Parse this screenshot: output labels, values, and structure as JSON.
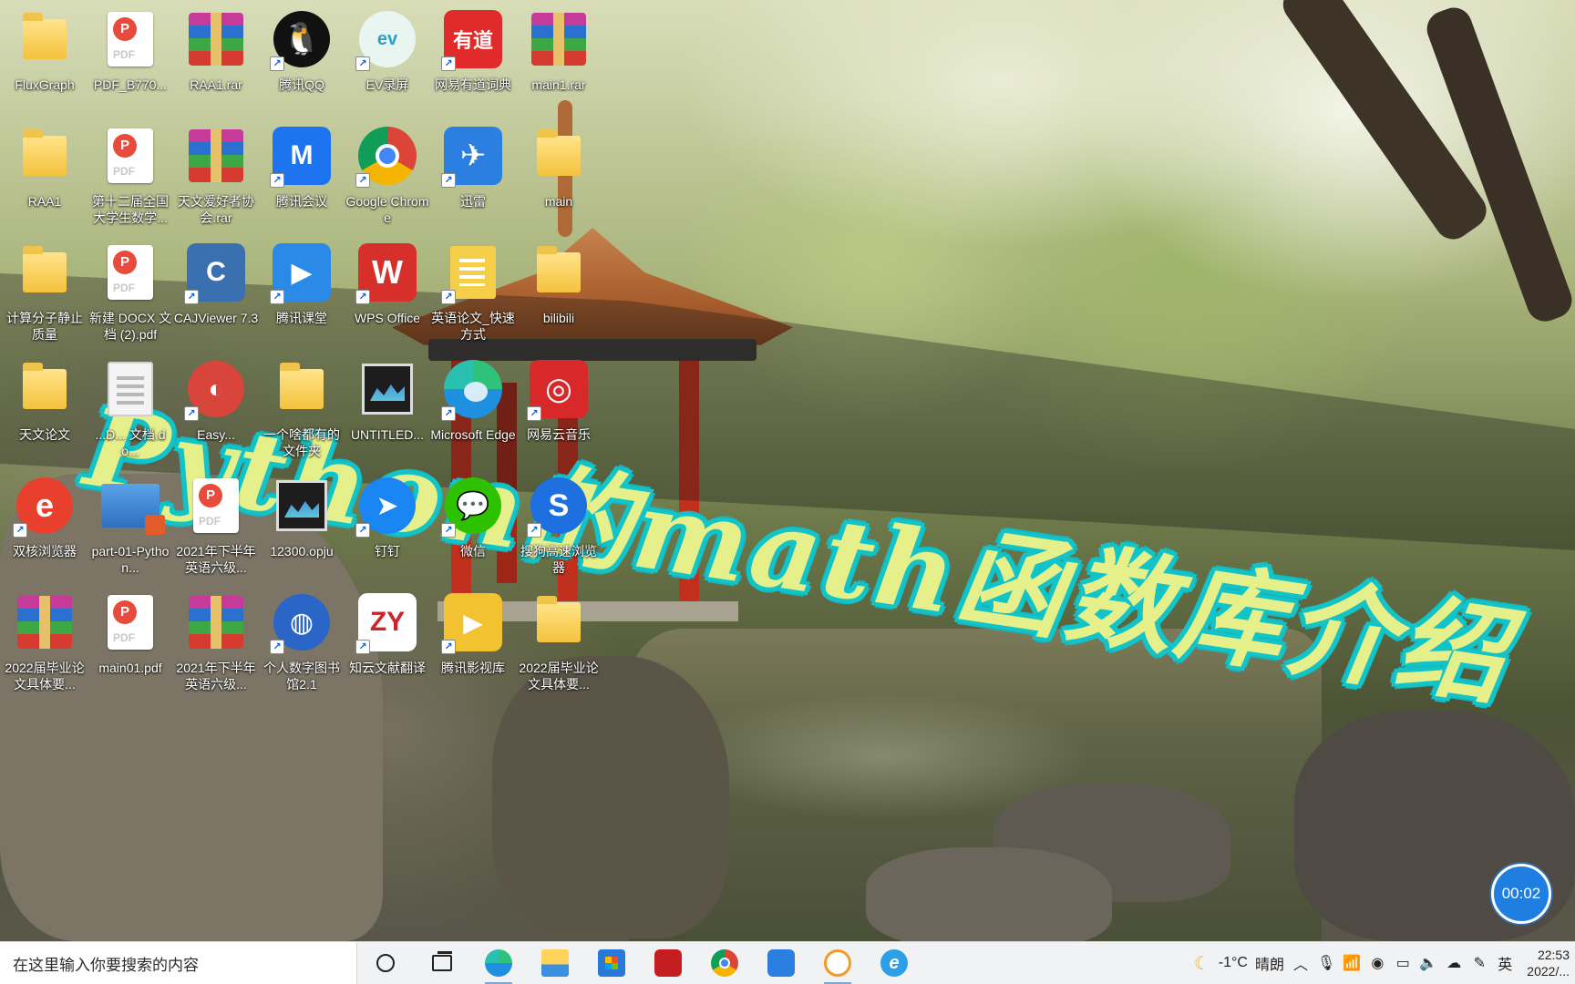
{
  "desktop": {
    "title_text": "Python的math函数库介绍",
    "icons": [
      {
        "label": "FluxGraph",
        "type": "folder",
        "shortcut": false
      },
      {
        "label": "PDF_B770...",
        "type": "pdf",
        "shortcut": false
      },
      {
        "label": "RAA1.rar",
        "type": "rar",
        "shortcut": false
      },
      {
        "label": "腾讯QQ",
        "type": "qq",
        "shortcut": true
      },
      {
        "label": "EV录屏",
        "type": "ev",
        "shortcut": true
      },
      {
        "label": "网易有道词典",
        "type": "youdao",
        "shortcut": true
      },
      {
        "label": "main1.rar",
        "type": "rar",
        "shortcut": false
      },
      {
        "label": "RAA1",
        "type": "folder",
        "shortcut": false
      },
      {
        "label": "第十二届全国大学生数学...",
        "type": "pdf",
        "shortcut": false
      },
      {
        "label": "天文爱好者协会.rar",
        "type": "rar",
        "shortcut": false
      },
      {
        "label": "腾讯会议",
        "type": "tencent-meeting",
        "shortcut": true
      },
      {
        "label": "Google Chrome",
        "type": "chrome",
        "shortcut": true
      },
      {
        "label": "迅雷",
        "type": "xunlei",
        "shortcut": true
      },
      {
        "label": "main",
        "type": "folder",
        "shortcut": false
      },
      {
        "label": "计算分子静止质量",
        "type": "folder",
        "shortcut": false
      },
      {
        "label": "新建 DOCX 文档 (2).pdf",
        "type": "pdf",
        "shortcut": false
      },
      {
        "label": "CAJViewer 7.3",
        "type": "caj",
        "shortcut": true
      },
      {
        "label": "腾讯课堂",
        "type": "tencent-class",
        "shortcut": true
      },
      {
        "label": "WPS Office",
        "type": "wps",
        "shortcut": true
      },
      {
        "label": "英语论文_快速方式",
        "type": "doc-color",
        "shortcut": true
      },
      {
        "label": "bilibili",
        "type": "folder",
        "shortcut": false
      },
      {
        "label": "天文论文",
        "type": "folder-doc",
        "shortcut": false
      },
      {
        "label": "...D... 文档.do...",
        "type": "doc",
        "shortcut": false
      },
      {
        "label": "Easy...",
        "type": "red-round",
        "shortcut": true
      },
      {
        "label": "一个啥都有的文件夹",
        "type": "folder-color",
        "shortcut": false
      },
      {
        "label": "UNTITLED...",
        "type": "origin",
        "shortcut": false
      },
      {
        "label": "Microsoft Edge",
        "type": "edge",
        "shortcut": true
      },
      {
        "label": "网易云音乐",
        "type": "netease-music",
        "shortcut": true
      },
      {
        "label": "双核浏览器",
        "type": "browser-e",
        "shortcut": true
      },
      {
        "label": "part-01-Python...",
        "type": "pptx",
        "shortcut": false
      },
      {
        "label": "2021年下半年英语六级...",
        "type": "pdf",
        "shortcut": false
      },
      {
        "label": "12300.opju",
        "type": "origin",
        "shortcut": false
      },
      {
        "label": "钉钉",
        "type": "dingtalk",
        "shortcut": true
      },
      {
        "label": "微信",
        "type": "wechat",
        "shortcut": true
      },
      {
        "label": "搜狗高速浏览器",
        "type": "sogou",
        "shortcut": true
      },
      {
        "label": "2022届毕业论文具体要...",
        "type": "rar",
        "shortcut": false
      },
      {
        "label": "main01.pdf",
        "type": "pdf",
        "shortcut": false
      },
      {
        "label": "2021年下半年英语六级...",
        "type": "rar",
        "shortcut": false
      },
      {
        "label": "个人数字图书馆2.1",
        "type": "digital-library",
        "shortcut": true
      },
      {
        "label": "知云文献翻译",
        "type": "zhiyun",
        "shortcut": true
      },
      {
        "label": "腾讯影视库",
        "type": "video-folder",
        "shortcut": true
      },
      {
        "label": "2022届毕业论文具体要...",
        "type": "folder-doc",
        "shortcut": false
      }
    ]
  },
  "recorder": {
    "timer": "00:02"
  },
  "taskbar": {
    "search_placeholder": "在这里输入你要搜索的内容",
    "apps": [
      "cortana",
      "task-view",
      "edge",
      "file-explorer",
      "microsoft-store",
      "red-app",
      "chrome",
      "xunlei",
      "ev-recorder",
      "internet-explorer"
    ],
    "tray": {
      "weather_temp": "-1°C",
      "weather_desc": "晴朗",
      "ime": "英",
      "time": "22:53",
      "date": "2022/..."
    }
  }
}
